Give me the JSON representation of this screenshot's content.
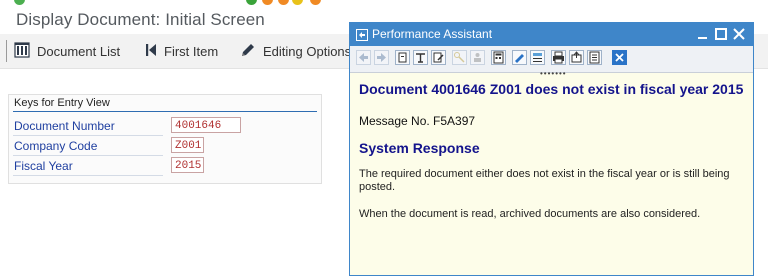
{
  "screen": {
    "title": "Display Document: Initial Screen"
  },
  "toolbar": {
    "document_list": "Document List",
    "first_item": "First Item",
    "editing_options": "Editing Options"
  },
  "keys_panel": {
    "header": "Keys for Entry View",
    "fields": [
      {
        "label": "Document Number",
        "value": "4001646"
      },
      {
        "label": "Company Code",
        "value": "Z001"
      },
      {
        "label": "Fiscal Year",
        "value": "2015"
      }
    ]
  },
  "performance_assistant": {
    "window_title": "Performance Assistant",
    "heading": "Document 4001646 Z001 does not exist in fiscal year 2015",
    "message_no": "Message No. F5A397",
    "section_title": "System Response",
    "paragraph1": "The required document either does not exist in the fiscal year or is still being posted.",
    "paragraph2": "When the document is read, archived documents are also considered."
  },
  "colors": {
    "pa_titlebar": "#3f86c9",
    "pa_background": "#fdfde9",
    "heading_text": "#14148c",
    "field_label": "#1f3fa0",
    "field_value": "#b03030"
  }
}
